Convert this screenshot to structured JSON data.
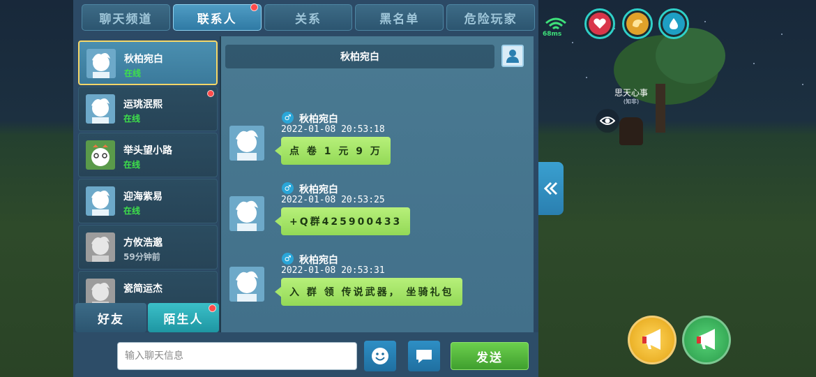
{
  "tabs": [
    {
      "label": "聊天频道"
    },
    {
      "label": "联系人"
    },
    {
      "label": "关系"
    },
    {
      "label": "黑名单"
    },
    {
      "label": "危险玩家"
    }
  ],
  "contacts": [
    {
      "name": "秋柏宛白",
      "status": "在线",
      "status_color": "#3ee04a"
    },
    {
      "name": "运珧泯熙",
      "status": "在线",
      "status_color": "#3ee04a"
    },
    {
      "name": "举头望小路",
      "status": "在线",
      "status_color": "#3ee04a"
    },
    {
      "name": "迎海紫易",
      "status": "在线",
      "status_color": "#3ee04a"
    },
    {
      "name": "方攸浩邈",
      "status": "59分钟前",
      "status_color": "#b8c6cf"
    },
    {
      "name": "瓷简运杰",
      "status": "",
      "status_color": "#b8c6cf"
    }
  ],
  "bottom_tabs": {
    "friends": "好友",
    "strangers": "陌生人"
  },
  "chat": {
    "title": "秋柏宛白",
    "messages": [
      {
        "name": "秋柏宛白",
        "time": "2022-01-08  20:53:18",
        "text": "点 卷 1 元 9 万"
      },
      {
        "name": "秋柏宛白",
        "time": "2022-01-08  20:53:25",
        "text": "+Q群425900433"
      },
      {
        "name": "秋柏宛白",
        "time": "2022-01-08  20:53:31",
        "text": "入 群 领 传说武器， 坐骑礼包"
      }
    ]
  },
  "input": {
    "placeholder": "输入聊天信息",
    "send_label": "发送"
  },
  "hud": {
    "ping": "68ms",
    "npc_name": "思天心事",
    "npc_sub": "(知非)"
  },
  "colors": {
    "accent": "#3a8fc0",
    "send": "#5cc043",
    "bubble": "#a6e66a"
  }
}
